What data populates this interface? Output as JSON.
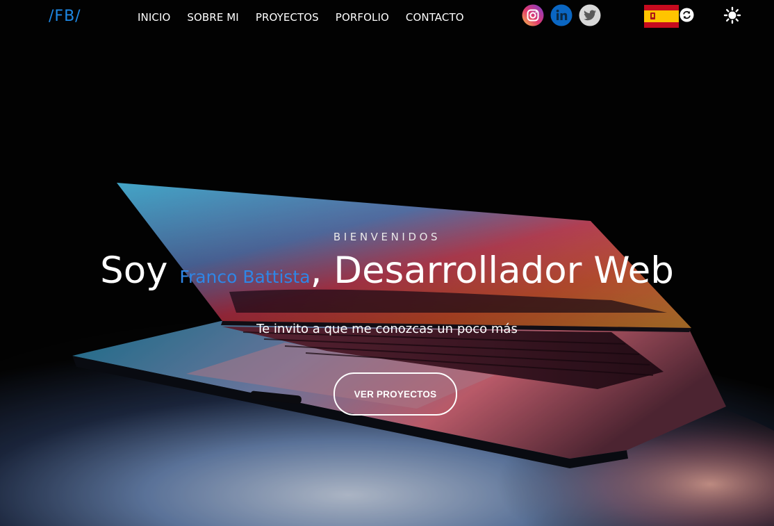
{
  "logo": "/FB/",
  "nav": {
    "items": [
      {
        "label": "INICIO"
      },
      {
        "label": "SOBRE MI"
      },
      {
        "label": "PROYECTOS"
      },
      {
        "label": "PORFOLIO"
      },
      {
        "label": "CONTACTO"
      }
    ]
  },
  "social": {
    "icons": [
      "instagram-icon",
      "linkedin-icon",
      "twitter-icon"
    ]
  },
  "language": {
    "flag_icon": "spain-flag-icon",
    "switch_icon": "refresh-icon"
  },
  "theme": {
    "icon": "sun-icon"
  },
  "hero": {
    "welcome": "BIENVENIDOS",
    "headline_prefix": "Soy ",
    "name": "Franco Battista",
    "headline_suffix": ", Desarrollador Web",
    "subtitle": "Te invito a que me conozcas un poco más",
    "cta_label": "VER PROYECTOS"
  },
  "colors": {
    "accent": "#2f86e6",
    "background": "#030303",
    "text": "#ffffff"
  }
}
